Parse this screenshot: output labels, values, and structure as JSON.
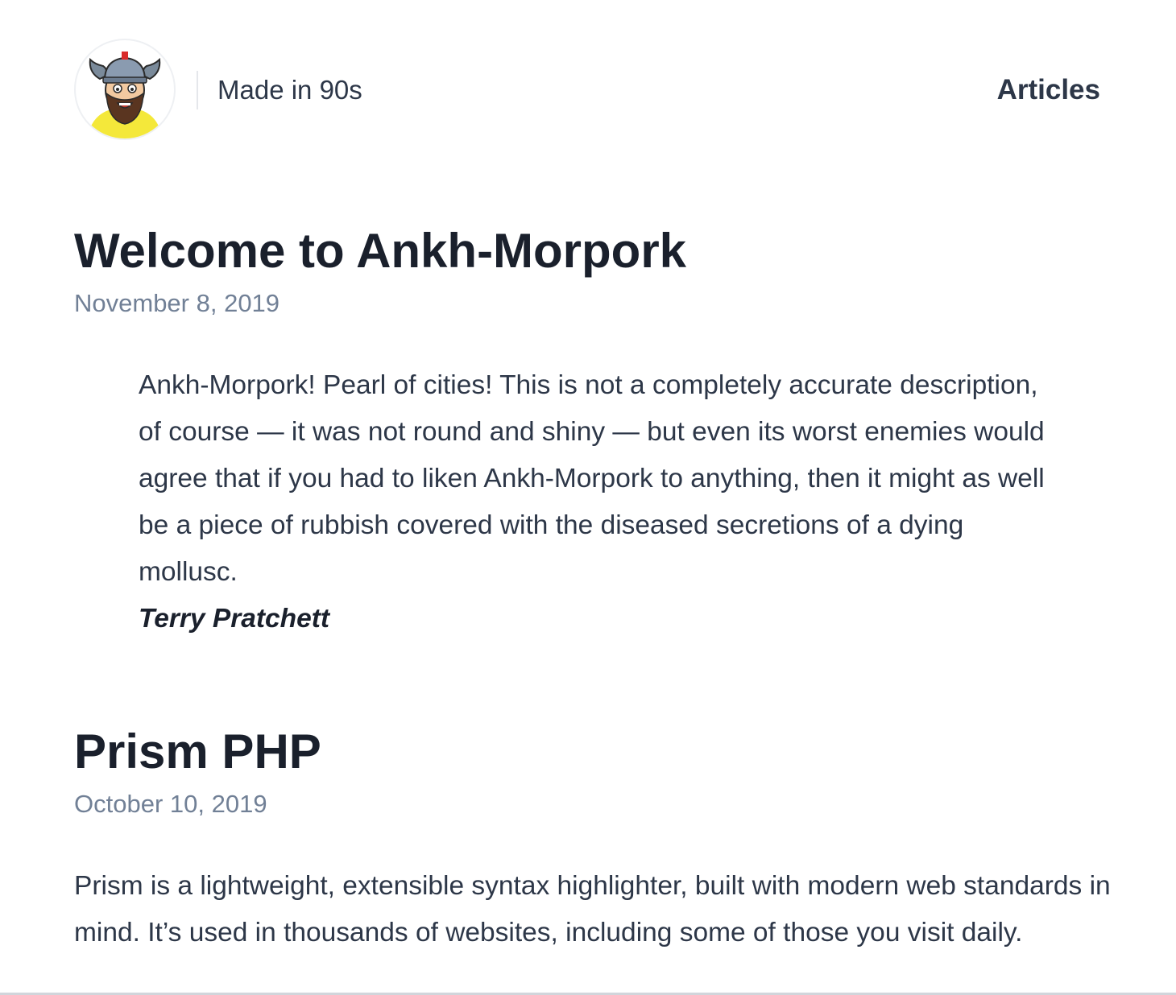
{
  "header": {
    "site_name": "Made in 90s",
    "nav": {
      "articles_label": "Articles"
    },
    "avatar_icon": "viking-avatar-icon"
  },
  "posts": [
    {
      "title": "Welcome to Ankh-Morpork",
      "date": "November 8, 2019",
      "quote": {
        "text": "Ankh-Morpork! Pearl of cities! This is not a completely accurate description, of course — it was not round and shiny — but even its worst enemies would agree that if you had to liken Ankh-Morpork to anything, then it might as well be a piece of rubbish covered with the diseased secretions of a dying mollusc.",
        "author": "Terry Pratchett"
      }
    },
    {
      "title": "Prism PHP",
      "date": "October 10, 2019",
      "excerpt": "Prism is a lightweight, extensible syntax highlighter, built with modern web standards in mind. It’s used in thousands of websites, including some of those you visit daily."
    }
  ],
  "colors": {
    "heading": "#1a202c",
    "body_text": "#2d3748",
    "date": "#718096",
    "avatar_shirt": "#f4e83a",
    "avatar_beard": "#5a3520"
  }
}
